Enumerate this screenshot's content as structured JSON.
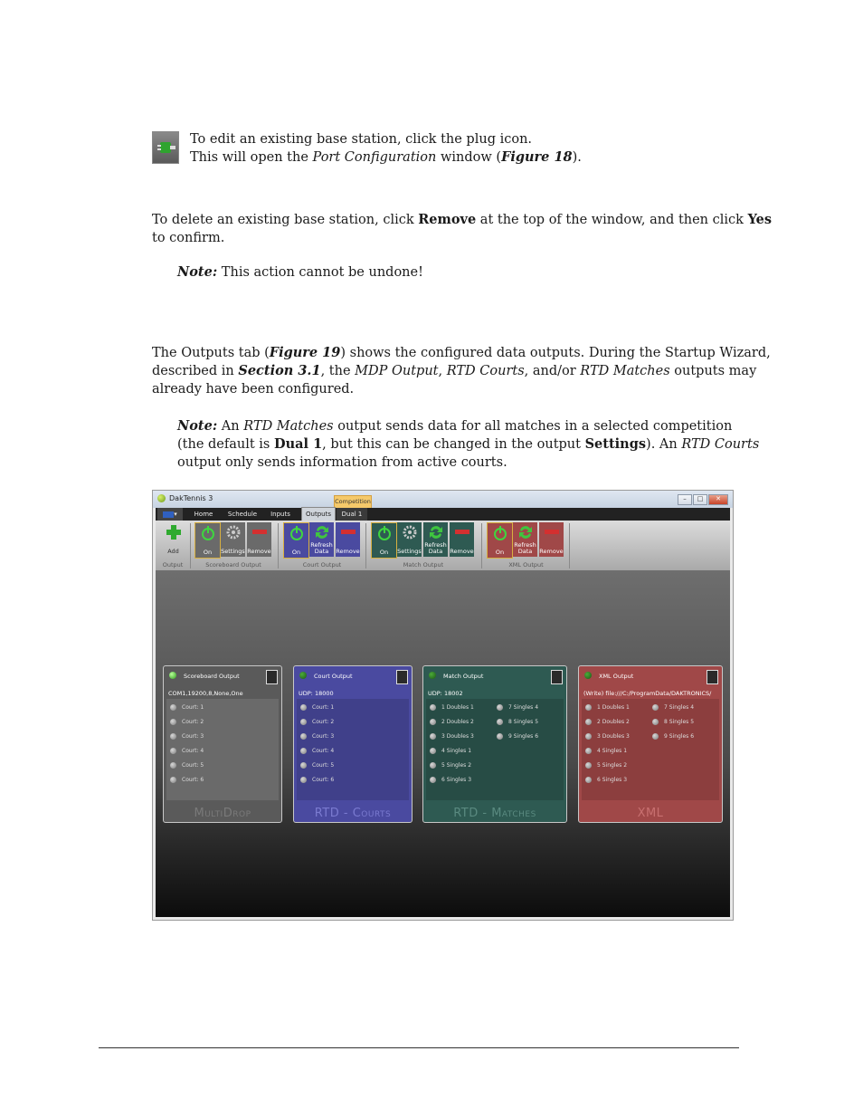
{
  "page": {
    "edit_line1": "To edit an existing base station, click the plug icon.",
    "edit_line2_a": "This will open the ",
    "edit_line2_b": "Port Configuration",
    "edit_line2_c": " window (",
    "edit_line2_d": "Figure 18",
    "edit_line2_e": ").",
    "delete_a": "To delete an existing base station, click ",
    "delete_b": "Remove",
    "delete_c": " at the top of the window, and then click ",
    "delete_d": "Yes",
    "delete_e": "to confirm.",
    "note1_label": "Note:",
    "note1_text": " This action cannot be undone!",
    "out_a": "The Outputs tab (",
    "out_b": "Figure 19",
    "out_c": ") shows the configured data outputs. During the Startup Wizard,",
    "out_d": "described in ",
    "out_e": "Section 3.1",
    "out_f": ", the ",
    "out_g": "MDP Output",
    "out_h": ", ",
    "out_i": "RTD Courts",
    "out_j": ", and/or ",
    "out_k": "RTD Matches",
    "out_l": " outputs may",
    "out_m": "already have been configured.",
    "note2_label": "Note:",
    "note2_a": " An ",
    "note2_b": "RTD Matches",
    "note2_c": " output sends data for all matches in a selected competition",
    "note2_d": "(the default is ",
    "note2_e": "Dual 1",
    "note2_f": ", but this can be changed in the output ",
    "note2_g": "Settings",
    "note2_h": "). An ",
    "note2_i": "RTD Courts",
    "note2_j": "output only sends information from active courts."
  },
  "app": {
    "title": "DakTennis 3",
    "competition_tab": "Competition",
    "menu": [
      "Home",
      "Schedule",
      "Inputs",
      "Outputs",
      "Dual 1"
    ],
    "ribbon": {
      "add": "Add",
      "on": "On",
      "settings": "Settings",
      "remove": "Remove",
      "refresh": "Refresh Data",
      "groups": [
        "Output",
        "Scoreboard Output",
        "Court Output",
        "Match Output",
        "XML Output"
      ]
    },
    "cards": [
      {
        "name": "Scoreboard Output",
        "sub": "COM1,19200,8,None,One",
        "footer": "MultiDrop",
        "color": "#5a5a5a",
        "items": [
          "Court: 1",
          "Court: 2",
          "Court: 3",
          "Court: 4",
          "Court: 5",
          "Court: 6"
        ]
      },
      {
        "name": "Court Output",
        "sub": "UDP: 18000",
        "footer": "RTD - Courts",
        "color": "#4a4aa0",
        "items": [
          "Court: 1",
          "Court: 2",
          "Court: 3",
          "Court: 4",
          "Court: 5",
          "Court: 6"
        ]
      },
      {
        "name": "Match Output",
        "sub": "UDP: 18002",
        "footer": "RTD - Matches",
        "color": "#2e5a52",
        "items": [
          "1  Doubles 1",
          "2  Doubles 2",
          "3  Doubles 3",
          "4  Singles 1",
          "5  Singles 2",
          "6  Singles 3",
          "7  Singles 4",
          "8  Singles 5",
          "9  Singles 6"
        ]
      },
      {
        "name": "XML Output",
        "sub": "(Write) file:///C:/ProgramData/DAKTRONICS/",
        "footer": "XML",
        "color": "#a04848",
        "items": [
          "1  Doubles 1",
          "2  Doubles 2",
          "3  Doubles 3",
          "4  Singles 1",
          "5  Singles 2",
          "6  Singles 3",
          "7  Singles 4",
          "8  Singles 5",
          "9  Singles 6"
        ]
      }
    ]
  }
}
